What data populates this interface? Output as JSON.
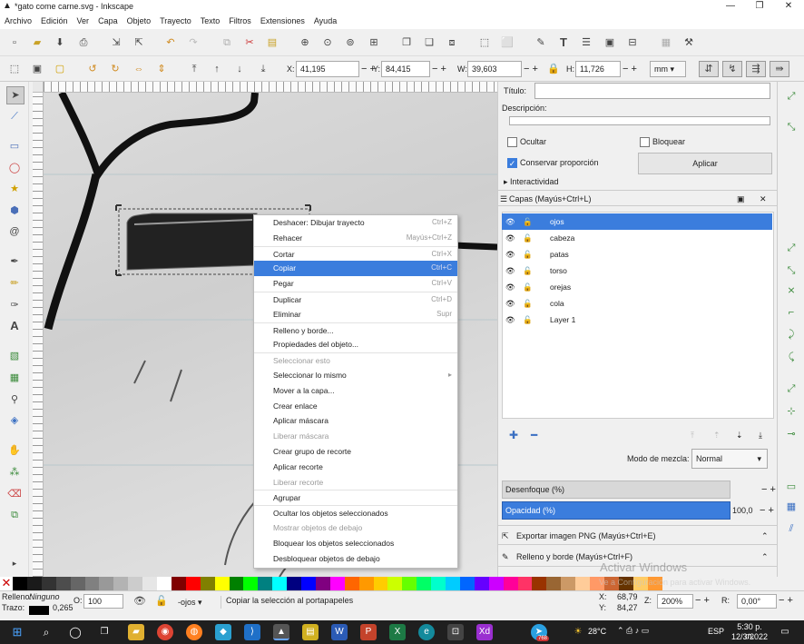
{
  "window": {
    "title": "*gato come carne.svg - Inkscape",
    "min": "—",
    "restore": "❐",
    "close": "✕"
  },
  "menu": [
    "Archivo",
    "Edición",
    "Ver",
    "Capa",
    "Objeto",
    "Trayecto",
    "Texto",
    "Filtros",
    "Extensiones",
    "Ayuda"
  ],
  "coords": {
    "x_label": "X:",
    "x": "41,195",
    "y_label": "Y:",
    "y": "84,415",
    "w_label": "W:",
    "w": "39,603",
    "h_label": "H:",
    "h": "11,726",
    "unit": "mm"
  },
  "context_menu": [
    {
      "label": "Deshacer: Dibujar trayecto",
      "shortcut": "Ctrl+Z",
      "state": "normal"
    },
    {
      "label": "Rehacer",
      "shortcut": "Mayús+Ctrl+Z",
      "state": "normal"
    },
    {
      "label": "Cortar",
      "shortcut": "Ctrl+X",
      "state": "normal",
      "sep": true
    },
    {
      "label": "Copiar",
      "shortcut": "Ctrl+C",
      "state": "selected"
    },
    {
      "label": "Pegar",
      "shortcut": "Ctrl+V",
      "state": "normal"
    },
    {
      "label": "Duplicar",
      "shortcut": "Ctrl+D",
      "state": "normal",
      "sep": true
    },
    {
      "label": "Eliminar",
      "shortcut": "Supr",
      "state": "normal"
    },
    {
      "label": "Relleno y borde...",
      "shortcut": "",
      "state": "normal",
      "sep": true
    },
    {
      "label": "Propiedades del objeto...",
      "shortcut": "",
      "state": "normal"
    },
    {
      "label": "Seleccionar esto",
      "shortcut": "",
      "state": "disabled",
      "sep": true
    },
    {
      "label": "Seleccionar lo mismo",
      "shortcut": "▸",
      "state": "normal"
    },
    {
      "label": "Mover a la capa...",
      "shortcut": "",
      "state": "normal"
    },
    {
      "label": "Crear enlace",
      "shortcut": "",
      "state": "normal"
    },
    {
      "label": "Aplicar máscara",
      "shortcut": "",
      "state": "normal"
    },
    {
      "label": "Liberar máscara",
      "shortcut": "",
      "state": "disabled"
    },
    {
      "label": "Crear grupo de recorte",
      "shortcut": "",
      "state": "normal"
    },
    {
      "label": "Aplicar recorte",
      "shortcut": "",
      "state": "normal"
    },
    {
      "label": "Liberar recorte",
      "shortcut": "",
      "state": "disabled"
    },
    {
      "label": "Agrupar",
      "shortcut": "",
      "state": "normal",
      "sep": true
    },
    {
      "label": "Ocultar los objetos seleccionados",
      "shortcut": "",
      "state": "normal",
      "sep": true
    },
    {
      "label": "Mostrar objetos de debajo",
      "shortcut": "",
      "state": "disabled"
    },
    {
      "label": "Bloquear los objetos seleccionados",
      "shortcut": "",
      "state": "normal"
    },
    {
      "label": "Desbloquear objetos de debajo",
      "shortcut": "",
      "state": "normal"
    }
  ],
  "object_props": {
    "title_label": "Título:",
    "title_value": "",
    "desc_label": "Descripción:",
    "hidden_label": "Ocultar",
    "lock_label": "Bloquear",
    "keep_ratio_label": "Conservar proporción",
    "apply_label": "Aplicar",
    "interactivity_label": "Interactividad"
  },
  "layers": {
    "header": "Capas (Mayús+Ctrl+L)",
    "items": [
      "ojos",
      "cabeza",
      "patas",
      "torso",
      "orejas",
      "cola",
      "Layer 1"
    ],
    "selected": "ojos",
    "blend_label": "Modo de mezcla:",
    "blend_value": "Normal",
    "blur_label": "Desenfoque (%)",
    "opacity_label": "Opacidad (%)",
    "opacity_value": "100,0"
  },
  "docks": {
    "export": "Exportar imagen PNG (Mayús+Ctrl+E)",
    "fill_stroke": "Relleno y borde (Mayús+Ctrl+F)",
    "watermark1": "Activar Windows",
    "watermark2": "Ve a Configuración para activar Windows."
  },
  "status": {
    "fill_label": "Relleno:",
    "fill_value": "Ninguno",
    "stroke_label": "Trazo:",
    "stroke_width": "0,265",
    "opacity_label": "O:",
    "opacity_value": "100",
    "layer_value": "-ojos",
    "message": "Copiar la selección al portapapeles",
    "x_label": "X:",
    "x": "68,79",
    "y_label": "Y:",
    "y": "84,27",
    "zoom_label": "Z:",
    "zoom": "200%",
    "rot_label": "R:",
    "rot": "0,00°"
  },
  "taskbar": {
    "temp": "28°C",
    "lang": "ESP",
    "time": "5:30 p. m.",
    "date": "12/3/2022",
    "badge": "768"
  },
  "palette": [
    "#000000",
    "#1a1a1a",
    "#333333",
    "#4d4d4d",
    "#666666",
    "#808080",
    "#999999",
    "#b3b3b3",
    "#cccccc",
    "#e6e6e6",
    "#ffffff",
    "#800000",
    "#ff0000",
    "#808000",
    "#ffff00",
    "#008000",
    "#00ff00",
    "#008080",
    "#00ffff",
    "#000080",
    "#0000ff",
    "#800080",
    "#ff00ff",
    "#ff6600",
    "#ff9900",
    "#ffcc00",
    "#ccff00",
    "#66ff00",
    "#00ff66",
    "#00ffcc",
    "#00ccff",
    "#0066ff",
    "#6600ff",
    "#cc00ff",
    "#ff0099",
    "#ff3366",
    "#993300",
    "#996633",
    "#cc9966",
    "#ffcc99",
    "#ff9966",
    "#cc6633",
    "#663300",
    "#ffcc66",
    "#ff9933"
  ]
}
